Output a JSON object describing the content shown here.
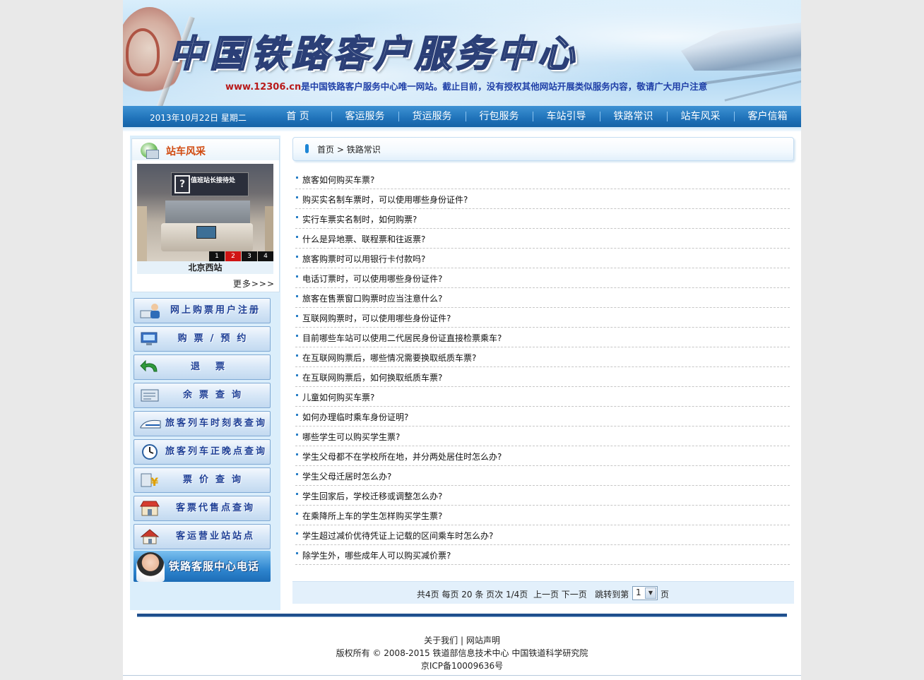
{
  "banner": {
    "title": "中国铁路客户服务中心",
    "url": "www.12306.cn",
    "notice": "是中国铁路客户服务中心唯一网站。截止目前，没有授权其他网站开展类似服务内容，敬请广大用户注意"
  },
  "nav": {
    "date": "2013年10月22日 星期二",
    "items": [
      "首 页",
      "客运服务",
      "货运服务",
      "行包服务",
      "车站引导",
      "铁路常识",
      "站车风采",
      "客户信箱"
    ]
  },
  "sidebar": {
    "station": {
      "title": "站车风采",
      "sign_text": "值班站长接待处",
      "caption": "北京西站",
      "pages": [
        "1",
        "2",
        "3",
        "4"
      ],
      "active_page": "2",
      "more": "更多>>>"
    },
    "quick_links": [
      {
        "label": "网上购票用户注册",
        "icon": "user-register-icon"
      },
      {
        "label": "购票/预约",
        "icon": "computer-ticket-icon"
      },
      {
        "label": "退票",
        "icon": "refund-arrow-icon"
      },
      {
        "label": "余票查询",
        "icon": "ticket-stack-icon"
      },
      {
        "label": "旅客列车时刻表查询",
        "icon": "train-icon"
      },
      {
        "label": "旅客列车正晚点查询",
        "icon": "clock-icon"
      },
      {
        "label": "票价查询",
        "icon": "yen-price-icon"
      },
      {
        "label": "客票代售点查询",
        "icon": "shop-icon"
      },
      {
        "label": "客运营业站站点",
        "icon": "house-icon"
      }
    ],
    "hotline": "铁路客服中心电话"
  },
  "breadcrumb": {
    "home": "首页",
    "sep": " > ",
    "current": "铁路常识"
  },
  "questions": [
    "旅客如何购买车票?",
    "购买实名制车票时，可以使用哪些身份证件?",
    "实行车票实名制时，如何购票?",
    "什么是异地票、联程票和往返票?",
    "旅客购票时可以用银行卡付款吗?",
    "电话订票时，可以使用哪些身份证件?",
    "旅客在售票窗口购票时应当注意什么?",
    "互联网购票时，可以使用哪些身份证件?",
    "目前哪些车站可以使用二代居民身份证直接检票乘车?",
    "在互联网购票后，哪些情况需要换取纸质车票?",
    "在互联网购票后，如何换取纸质车票?",
    "儿童如何购买车票?",
    "如何办理临时乘车身份证明?",
    "哪些学生可以购买学生票?",
    "学生父母都不在学校所在地，并分两处居住时怎么办?",
    "学生父母迁居时怎么办?",
    "学生回家后，学校迁移或调整怎么办?",
    "在乘降所上车的学生怎样购买学生票?",
    "学生超过减价优待凭证上记载的区间乘车时怎么办?",
    "除学生外，哪些成年人可以购买减价票?"
  ],
  "pager": {
    "summary": "共4页 每页 20 条 页次 1/4页",
    "prev": "上一页",
    "next": "下一页",
    "jump": "跳转到第",
    "selected": "1",
    "page_word": "页"
  },
  "footer": {
    "about": "关于我们",
    "divider": " | ",
    "statement": "网站声明",
    "copyright": "版权所有 © 2008-2015 铁道部信息技术中心 中国铁道科学研究院",
    "icp": "京ICP备10009636号"
  }
}
